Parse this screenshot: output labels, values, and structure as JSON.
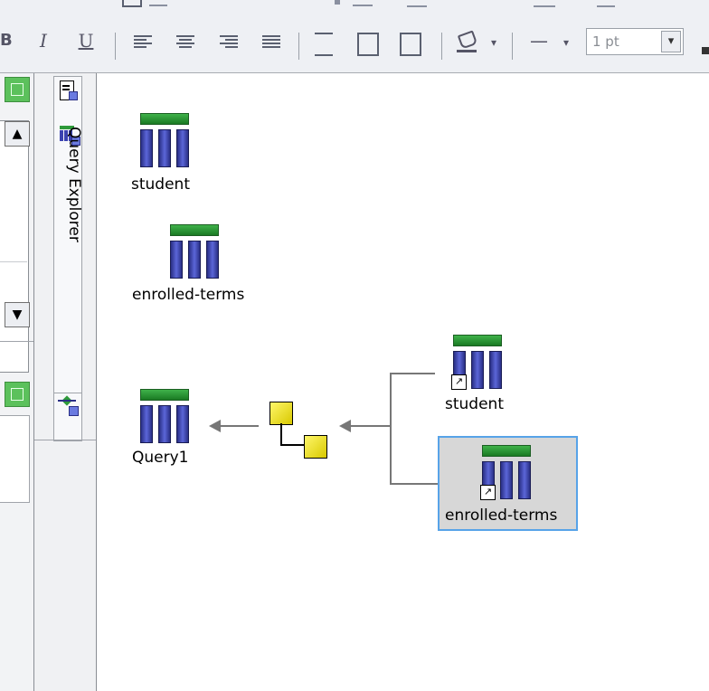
{
  "toolbar": {
    "italic_label": "I",
    "underline_label": "U",
    "bold_label": "B",
    "line_width_value": "1 pt",
    "line_style_glyph": "—",
    "dropdown_glyph": "▾"
  },
  "left_panel": {
    "scroll_up": "▲",
    "scroll_down": "▼"
  },
  "explorer": {
    "title": "Query Explorer"
  },
  "canvas": {
    "tables": [
      {
        "label": "student"
      },
      {
        "label": "enrolled-terms"
      },
      {
        "label": "Query1"
      },
      {
        "label": "student",
        "shortcut": true
      },
      {
        "label": "enrolled-terms",
        "shortcut": true,
        "selected": true
      }
    ],
    "shortcut_glyph": "↗"
  },
  "colors": {
    "accent": "#57a3e8",
    "table_header": "#2e9a3a",
    "table_columns": "#3a42b0",
    "join_node": "#e8dc10",
    "connector": "#777777"
  }
}
